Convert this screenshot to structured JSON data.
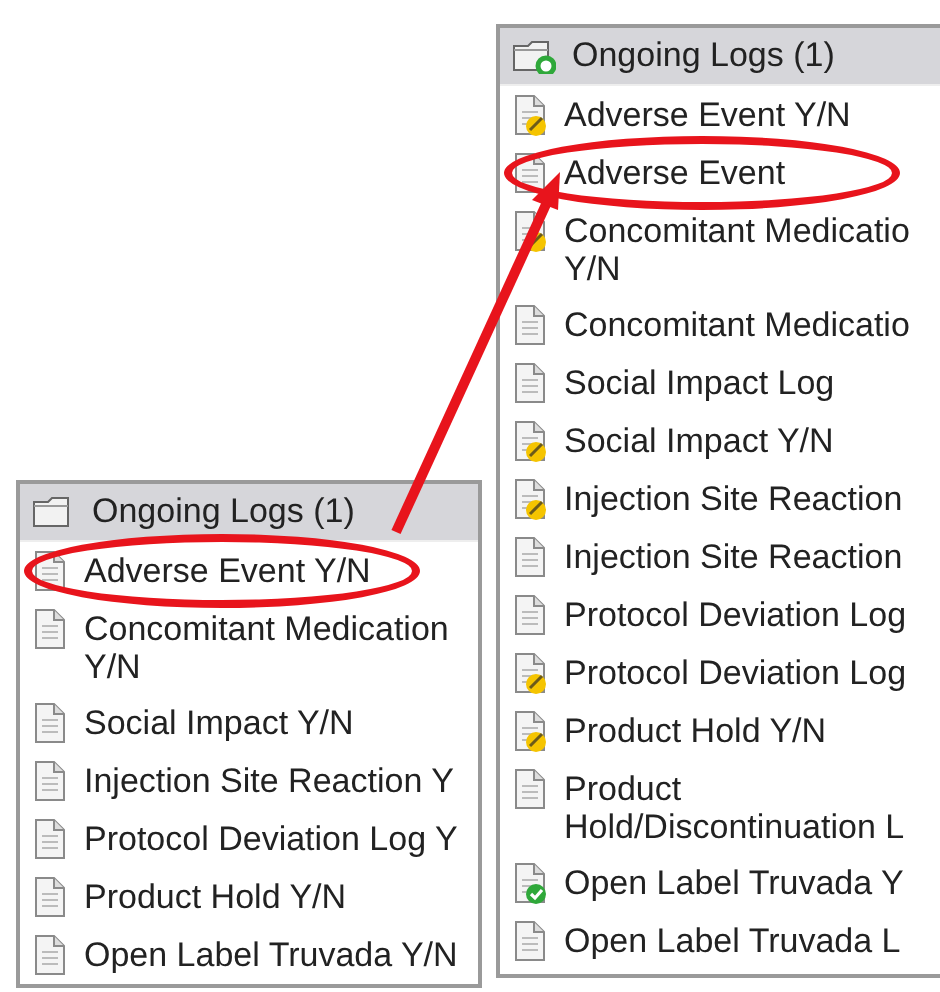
{
  "panels": [
    {
      "header": {
        "title": "Ongoing Logs (1)",
        "badge": false
      },
      "items": [
        {
          "label": "Adverse Event Y/N",
          "kind": "plain",
          "highlighted": true
        },
        {
          "label": "Concomitant Medication\nY/N",
          "kind": "plain",
          "highlighted": false
        },
        {
          "label": "Social Impact Y/N",
          "kind": "plain",
          "highlighted": false
        },
        {
          "label": "Injection Site Reaction Y",
          "kind": "plain",
          "highlighted": false
        },
        {
          "label": "Protocol Deviation Log Y",
          "kind": "plain",
          "highlighted": false
        },
        {
          "label": "Product Hold Y/N",
          "kind": "plain",
          "highlighted": false
        },
        {
          "label": "Open Label Truvada Y/N",
          "kind": "plain",
          "highlighted": false
        }
      ]
    },
    {
      "header": {
        "title": "Ongoing Logs (1)",
        "badge": true
      },
      "items": [
        {
          "label": "Adverse Event Y/N",
          "kind": "edited",
          "highlighted": false
        },
        {
          "label": "Adverse Event",
          "kind": "plain",
          "highlighted": true
        },
        {
          "label": "Concomitant Medicatio\nY/N",
          "kind": "edited",
          "highlighted": false
        },
        {
          "label": "Concomitant Medicatio",
          "kind": "plain",
          "highlighted": false
        },
        {
          "label": "Social Impact Log",
          "kind": "plain",
          "highlighted": false
        },
        {
          "label": "Social Impact Y/N",
          "kind": "edited",
          "highlighted": false
        },
        {
          "label": "Injection Site Reaction",
          "kind": "edited",
          "highlighted": false
        },
        {
          "label": "Injection Site Reaction",
          "kind": "plain",
          "highlighted": false
        },
        {
          "label": "Protocol Deviation Log",
          "kind": "plain",
          "highlighted": false
        },
        {
          "label": "Protocol Deviation Log",
          "kind": "edited",
          "highlighted": false
        },
        {
          "label": "Product Hold Y/N",
          "kind": "edited",
          "highlighted": false
        },
        {
          "label": "Product\nHold/Discontinuation L",
          "kind": "plain",
          "highlighted": false
        },
        {
          "label": "Open Label Truvada Y",
          "kind": "complete",
          "highlighted": false
        },
        {
          "label": "Open Label Truvada L",
          "kind": "plain",
          "highlighted": false
        }
      ]
    }
  ]
}
